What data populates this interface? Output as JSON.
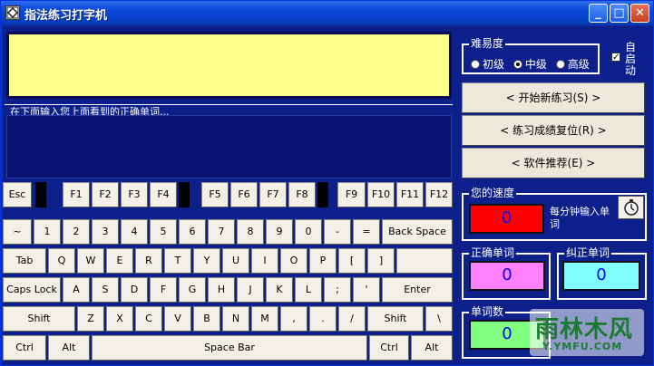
{
  "window": {
    "title": "指法练习打字机",
    "minimize_glyph": "_",
    "maximize_glyph": "□",
    "close_glyph": "✕"
  },
  "practice": {
    "target_text": "",
    "input_caption": "在下面输入您上面看到的正确单词...",
    "input_value": ""
  },
  "keyboard": {
    "fn_row": [
      "Esc",
      "F1",
      "F2",
      "F3",
      "F4",
      "F5",
      "F6",
      "F7",
      "F8",
      "F9",
      "F10",
      "F11",
      "F12"
    ],
    "number_row": [
      "~",
      "1",
      "2",
      "3",
      "4",
      "5",
      "6",
      "7",
      "8",
      "9",
      "0",
      "-",
      "=",
      "Back Space"
    ],
    "top_row": [
      "Tab",
      "Q",
      "W",
      "E",
      "R",
      "T",
      "Y",
      "U",
      "I",
      "O",
      "P",
      "[",
      "]",
      ""
    ],
    "home_row": [
      "Caps Lock",
      "A",
      "S",
      "D",
      "F",
      "G",
      "H",
      "J",
      "K",
      "L",
      ";",
      "'",
      "Enter"
    ],
    "bottom_row": [
      "Shift",
      "Z",
      "X",
      "C",
      "V",
      "B",
      "N",
      "M",
      ",",
      ".",
      "/",
      "Shift",
      "\\"
    ],
    "space_row": [
      "Ctrl",
      "Alt",
      "Space Bar",
      "Ctrl",
      "Alt"
    ]
  },
  "difficulty": {
    "legend": "难易度",
    "options": [
      "初级",
      "中级",
      "高级"
    ],
    "selected": "中级",
    "autostart_label": "自启动",
    "autostart_checked": true
  },
  "buttons": {
    "new_practice": "< 开始新练习(S) >",
    "reset_score": "< 练习成绩复位(R) >",
    "recommend": "< 软件推荐(E) >"
  },
  "stats": {
    "speed_legend": "您的速度",
    "speed_value": "0",
    "speed_unit": "每分钟输入单词",
    "correct_legend": "正确单词",
    "correct_value": "0",
    "corrected_legend": "纠正单词",
    "corrected_value": "0",
    "word_count_legend": "单词数",
    "word_count_value": "0"
  },
  "watermark": {
    "main": "雨林木风",
    "sub": "Y.YMFU.COM"
  },
  "colors": {
    "target_bg": "#fefe8c",
    "speed_bg": "#ff0000",
    "correct_bg": "#ff80ff",
    "corrected_bg": "#80ffff",
    "word_count_bg": "#80ff80",
    "panel_bg": "#0c1f8a"
  },
  "icons": {
    "app": "app-icon",
    "timer": "stopwatch-icon"
  }
}
